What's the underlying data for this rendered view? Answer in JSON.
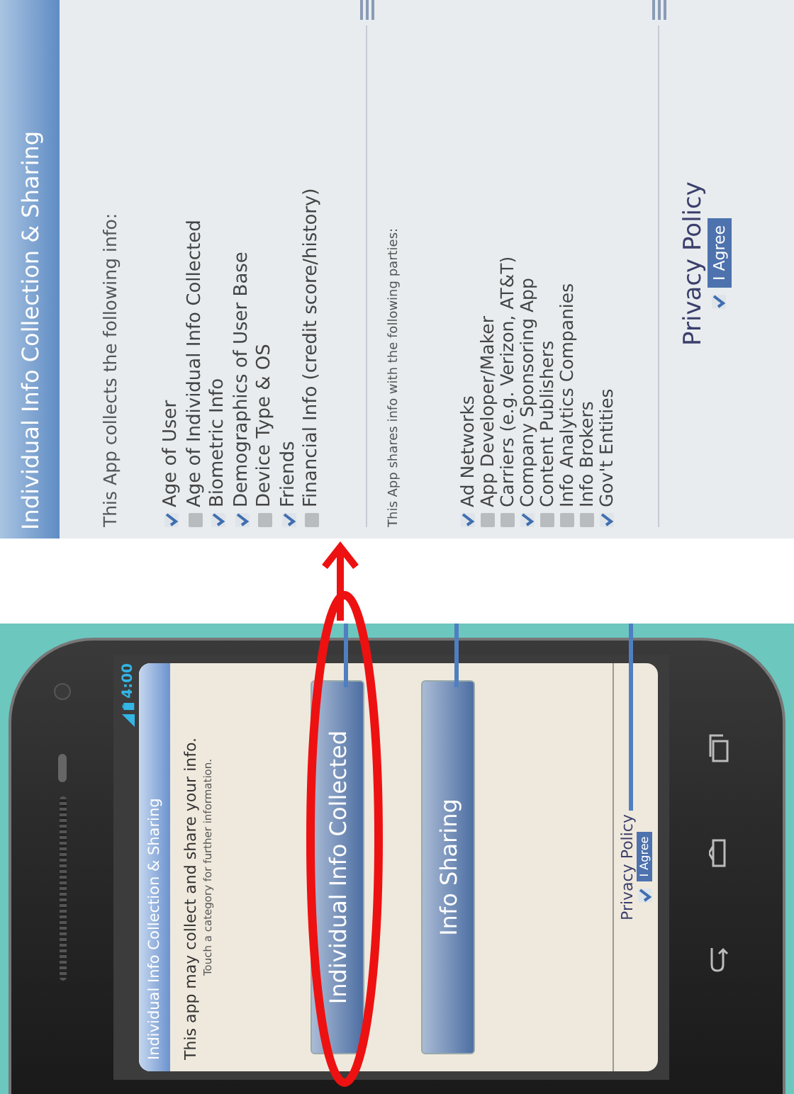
{
  "phone": {
    "status_bar": {
      "time": "4:00"
    },
    "screen": {
      "title": "Individual Info Collection & Sharing",
      "intro": "This app may collect and share your info.",
      "hint": "Touch a category for further information.",
      "categories": [
        {
          "label": "Individual Info Collected",
          "circled": true
        },
        {
          "label": "Info Sharing",
          "circled": false
        }
      ],
      "privacy_policy": {
        "label": "Privacy Policy",
        "agree_label": "I Agree",
        "checked": true
      }
    }
  },
  "detail": {
    "title": "Individual Info Collection & Sharing",
    "collects_heading": "This App collects the following info:",
    "collected": [
      {
        "label": "Age of User",
        "checked": true
      },
      {
        "label": "Age of Individual Info Collected",
        "checked": false
      },
      {
        "label": "Biometric Info",
        "checked": true
      },
      {
        "label": "Demographics of User Base",
        "checked": true
      },
      {
        "label": "Device Type & OS",
        "checked": false
      },
      {
        "label": "Friends",
        "checked": true
      },
      {
        "label": "Financial Info (credit score/history)",
        "checked": false
      }
    ],
    "shares_heading": "This App shares info with the following parties:",
    "parties": [
      {
        "label": "Ad Networks",
        "checked": true
      },
      {
        "label": "App Developer/Maker",
        "checked": false
      },
      {
        "label": "Carriers (e.g. Verizon, AT&T)",
        "checked": false
      },
      {
        "label": "Company Sponsoring App",
        "checked": true
      },
      {
        "label": "Content Publishers",
        "checked": false
      },
      {
        "label": "Info Analytics Companies",
        "checked": false
      },
      {
        "label": "Info Brokers",
        "checked": false
      },
      {
        "label": "Gov't Entities",
        "checked": true
      }
    ],
    "privacy_policy": {
      "label": "Privacy Policy",
      "agree_label": "I Agree",
      "checked": true
    }
  }
}
